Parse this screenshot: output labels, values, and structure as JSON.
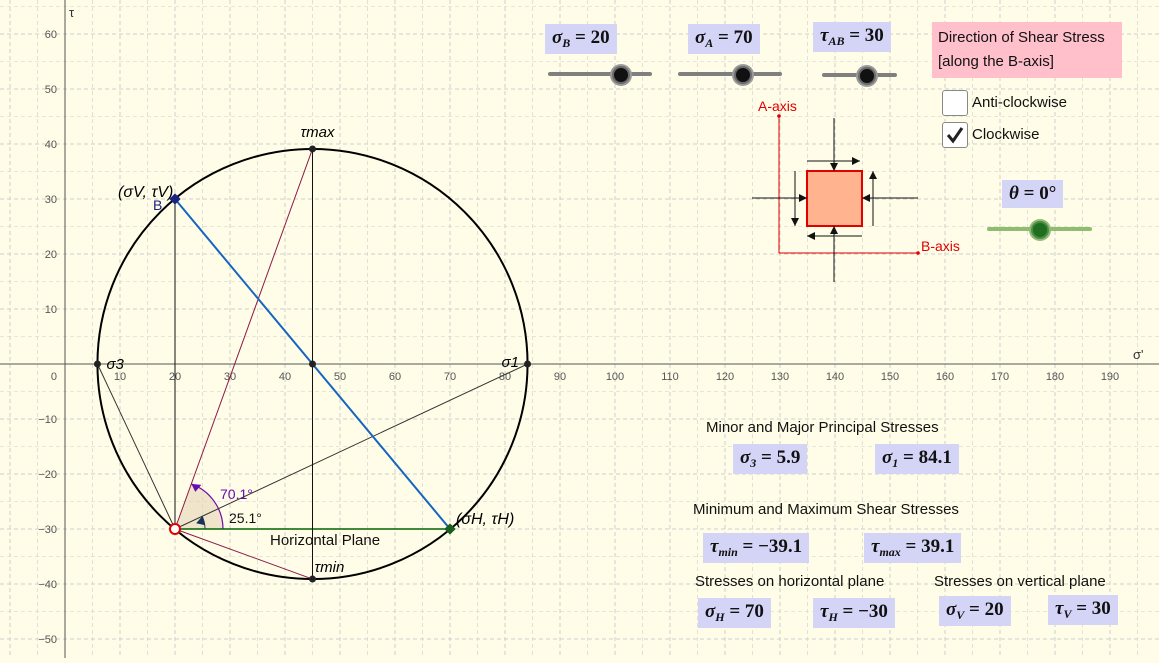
{
  "axes": {
    "y_axis_label": "τ",
    "x_axis_label": "σ'",
    "x_ticks": [
      "10",
      "20",
      "30",
      "40",
      "50",
      "60",
      "70",
      "80",
      "90",
      "100",
      "110",
      "120",
      "130",
      "140",
      "150",
      "160",
      "170",
      "180",
      "190"
    ],
    "y_ticks": [
      "60",
      "50",
      "40",
      "30",
      "20",
      "10",
      "0",
      "-10",
      "-20",
      "-30",
      "-40",
      "-50"
    ]
  },
  "sliders": {
    "sigma_B": {
      "symbol": "σ",
      "sub": "B",
      "value": "20",
      "level": 0.7
    },
    "sigma_A": {
      "symbol": "σ",
      "sub": "A",
      "value": "70",
      "level": 0.6
    },
    "tau_AB": {
      "symbol": "τ",
      "sub": "AB",
      "value": "30",
      "level": 0.6
    },
    "theta": {
      "symbol": "θ",
      "value": "0°",
      "level": 0.5
    }
  },
  "shear_direction": {
    "title_line1": "Direction of Shear Stress",
    "title_line2": "[along the B-axis]",
    "options": [
      {
        "label": "Anti-clockwise",
        "checked": false
      },
      {
        "label": "Clockwise",
        "checked": true
      }
    ]
  },
  "element": {
    "a_axis": "A-axis",
    "b_axis": "B-axis",
    "fill": "#ffb38f",
    "stroke": "#e00000"
  },
  "mohr": {
    "center": 45,
    "radius": 39.1,
    "labels": {
      "tau_max": "τmax",
      "tau_min": "τmin",
      "sigma_3": "σ3",
      "sigma_1": "σ1",
      "point_v": "(σV, τV)",
      "point_h": "(σH, τH)",
      "point_b": "B",
      "horizontal_plane": "Horizontal Plane",
      "angle_1": "70.1°",
      "angle_2": "25.1°"
    }
  },
  "results": {
    "principal_heading": "Minor and Major Principal Stresses",
    "sigma_3": {
      "sym": "σ",
      "sub": "3",
      "value": "5.9"
    },
    "sigma_1": {
      "sym": "σ",
      "sub": "1",
      "value": "84.1"
    },
    "shear_heading": "Minimum and Maximum Shear Stresses",
    "tau_min": {
      "sym": "τ",
      "sub": "min",
      "value": "−39.1"
    },
    "tau_max": {
      "sym": "τ",
      "sub": "max",
      "value": "39.1"
    },
    "horizontal_heading": "Stresses on horizontal plane",
    "vertical_heading": "Stresses on vertical plane",
    "sigma_H": {
      "sym": "σ",
      "sub": "H",
      "value": "70"
    },
    "tau_H": {
      "sym": "τ",
      "sub": "H",
      "value": "−30"
    },
    "sigma_V": {
      "sym": "σ",
      "sub": "V",
      "value": "20"
    },
    "tau_V": {
      "sym": "τ",
      "sub": "V",
      "value": "30"
    }
  },
  "colors": {
    "grid": "#cfcfcf",
    "axis": "#555555",
    "circle": "#000000",
    "blue_line": "#1565c0",
    "purple": "#6a0dad",
    "green": "#006400",
    "red_point": "#e00000",
    "box": "#d4d4f7"
  }
}
